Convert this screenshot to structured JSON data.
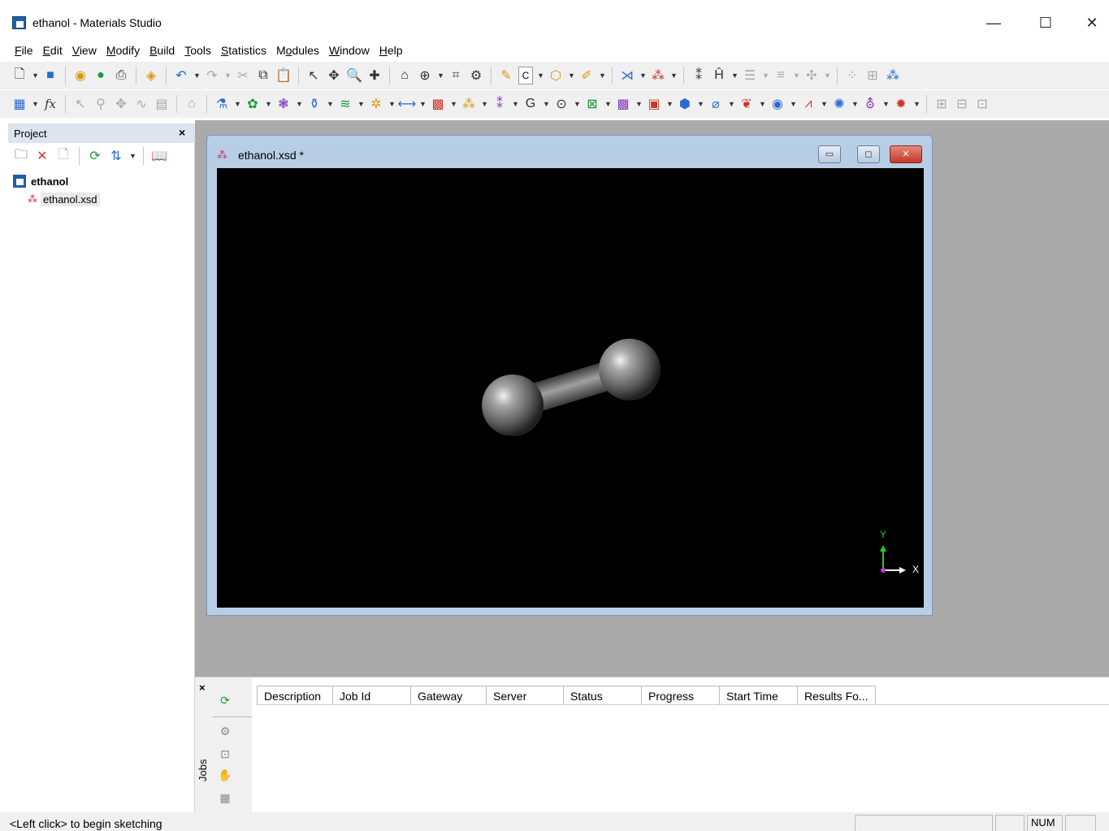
{
  "window": {
    "title": "ethanol - Materials Studio",
    "min_icon": "minimize-icon",
    "max_icon": "maximize-icon",
    "close_icon": "close-icon",
    "min_glyph": "—",
    "max_glyph": "☐",
    "close_glyph": "✕"
  },
  "menu": [
    {
      "label": "File",
      "mnemonic": "F"
    },
    {
      "label": "Edit",
      "mnemonic": "E"
    },
    {
      "label": "View",
      "mnemonic": "V"
    },
    {
      "label": "Modify",
      "mnemonic": "M"
    },
    {
      "label": "Build",
      "mnemonic": "B"
    },
    {
      "label": "Tools",
      "mnemonic": "T"
    },
    {
      "label": "Statistics",
      "mnemonic": "S"
    },
    {
      "label": "Modules",
      "mnemonic": "o"
    },
    {
      "label": "Window",
      "mnemonic": "W"
    },
    {
      "label": "Help",
      "mnemonic": "H"
    }
  ],
  "toolbar": {
    "element_field_value": "C",
    "function_label": "fx"
  },
  "project": {
    "title": "Project",
    "close_glyph": "×",
    "tree": {
      "root": "ethanol",
      "children": [
        "ethanol.xsd"
      ]
    }
  },
  "document": {
    "title": "ethanol.xsd *",
    "min_glyph": "▭",
    "max_glyph": "◻",
    "close_glyph": "✕"
  },
  "axes": {
    "y_label": "Y",
    "x_label": "X",
    "x_color": "#ffffff",
    "y_color": "#22cc22",
    "origin_color": "#cc33cc"
  },
  "jobs": {
    "label": "Jobs",
    "close_glyph": "×",
    "columns": [
      "Description",
      "Job Id",
      "Gateway",
      "Server",
      "Status",
      "Progress",
      "Start Time",
      "Results Fo..."
    ]
  },
  "status": {
    "text": "<Left click> to begin sketching",
    "num": "NUM"
  },
  "colors": {
    "viewport_bg": "#000000",
    "mdi_bg": "#aaaaaa",
    "doc_frame": "#b7cee6",
    "atom": "#8c8c8c"
  }
}
